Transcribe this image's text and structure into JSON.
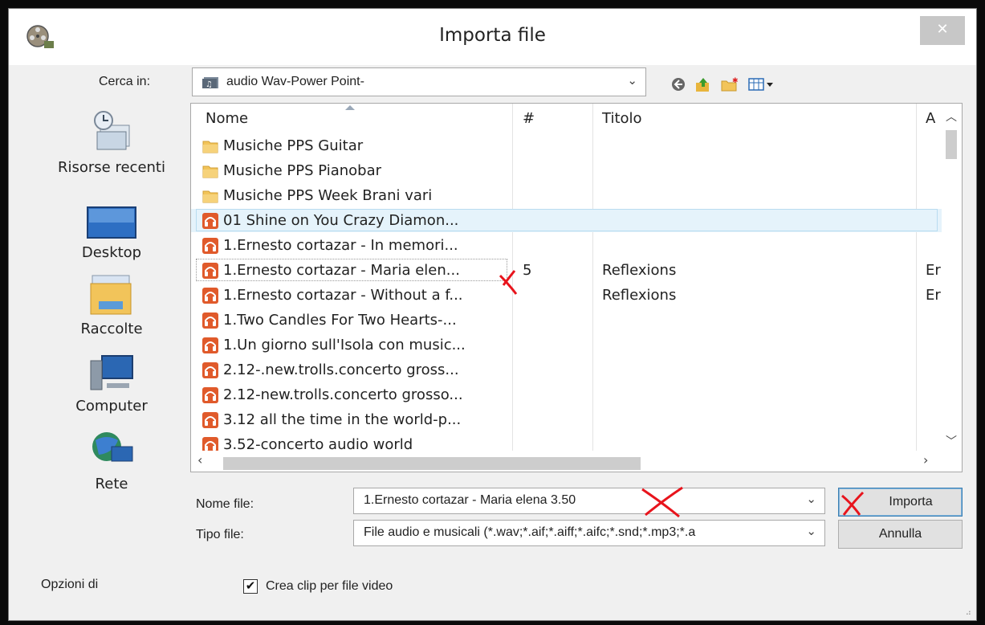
{
  "window": {
    "title": "Importa file",
    "close_glyph": "✕"
  },
  "lookin": {
    "label": "Cerca in:",
    "value": "audio Wav-Power Point-"
  },
  "toolbar_icons": [
    "back-icon",
    "up-folder-icon",
    "new-folder-icon",
    "view-menu-icon"
  ],
  "places": [
    {
      "label": "Risorse recenti",
      "icon": "recent-places-icon"
    },
    {
      "label": "Desktop",
      "icon": "desktop-icon"
    },
    {
      "label": "Raccolte",
      "icon": "libraries-icon"
    },
    {
      "label": "Computer",
      "icon": "computer-icon"
    },
    {
      "label": "Rete",
      "icon": "network-icon"
    }
  ],
  "columns": {
    "name": "Nome",
    "number": "#",
    "title": "Titolo",
    "artist": "A"
  },
  "files": [
    {
      "type": "folder",
      "name": "Musiche PPS Guitar",
      "number": "",
      "title": "",
      "artist": ""
    },
    {
      "type": "folder",
      "name": "Musiche PPS Pianobar",
      "number": "",
      "title": "",
      "artist": ""
    },
    {
      "type": "folder",
      "name": "Musiche PPS Week Brani vari",
      "number": "",
      "title": "",
      "artist": ""
    },
    {
      "type": "audio",
      "name": "01 Shine on You Crazy Diamon...",
      "number": "",
      "title": "",
      "artist": ""
    },
    {
      "type": "audio",
      "name": "1.Ernesto cortazar - In memori...",
      "number": "",
      "title": "",
      "artist": ""
    },
    {
      "type": "audio",
      "name": "1.Ernesto cortazar - Maria elen...",
      "number": "5",
      "title": "Reflexions",
      "artist": "Er"
    },
    {
      "type": "audio",
      "name": "1.Ernesto cortazar - Without a f...",
      "number": "",
      "title": "Reflexions",
      "artist": "Er"
    },
    {
      "type": "audio",
      "name": "1.Two Candles For Two Hearts-...",
      "number": "",
      "title": "",
      "artist": ""
    },
    {
      "type": "audio",
      "name": "1.Un giorno sull'Isola con music...",
      "number": "",
      "title": "",
      "artist": ""
    },
    {
      "type": "audio",
      "name": "2.12-.new.trolls.concerto gross...",
      "number": "",
      "title": "",
      "artist": ""
    },
    {
      "type": "audio",
      "name": "2.12-new.trolls.concerto grosso...",
      "number": "",
      "title": "",
      "artist": ""
    },
    {
      "type": "audio",
      "name": "3.12 all the time in the world-p...",
      "number": "",
      "title": "",
      "artist": ""
    },
    {
      "type": "audio",
      "name": "3.52-concerto audio world",
      "number": "",
      "title": "",
      "artist": ""
    }
  ],
  "filename": {
    "label": "Nome file:",
    "value": "1.Ernesto cortazar - Maria elena 3.50"
  },
  "filetype": {
    "label": "Tipo file:",
    "value": "File audio e musicali (*.wav;*.aif;*.aiff;*.aifc;*.snd;*.mp3;*.a"
  },
  "buttons": {
    "import": "Importa",
    "cancel": "Annulla"
  },
  "options": {
    "label": "Opzioni di",
    "checkbox_label": "Crea clip per file video",
    "checked": true,
    "check_glyph": "✔"
  },
  "colors": {
    "selection": "#e5f3fb",
    "audio_icon": "#e05a2b",
    "folder": "#f2c45a",
    "annotation": "#e8141c"
  }
}
